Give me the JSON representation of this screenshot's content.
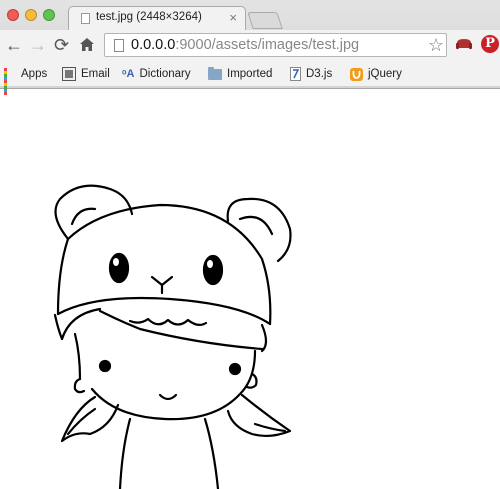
{
  "tab": {
    "title": "test.jpg (2448×3264)",
    "close_glyph": "×"
  },
  "toolbar": {
    "url_host": "0.0.0.0",
    "url_rest": ":9000/assets/images/test.jpg",
    "back_icon": "back-arrow-icon",
    "forward_icon": "forward-arrow-icon",
    "reload_icon": "reload-icon",
    "home_icon": "home-icon",
    "star_icon": "bookmark-star-icon"
  },
  "bookmarks": [
    {
      "label": "Apps",
      "icon": "apps-grid-icon"
    },
    {
      "label": "Email",
      "icon": "email-icon"
    },
    {
      "label": "Dictionary",
      "icon": "dictionary-icon"
    },
    {
      "label": "Imported",
      "icon": "folder-icon"
    },
    {
      "label": "D3.js",
      "icon": "bookmark-page-icon"
    },
    {
      "label": "jQuery",
      "icon": "jquery-icon"
    }
  ],
  "colors": {
    "close": "#f25b53",
    "minimize": "#f6bd3b",
    "maximize": "#60c453",
    "pinterest": "#cb2027"
  }
}
